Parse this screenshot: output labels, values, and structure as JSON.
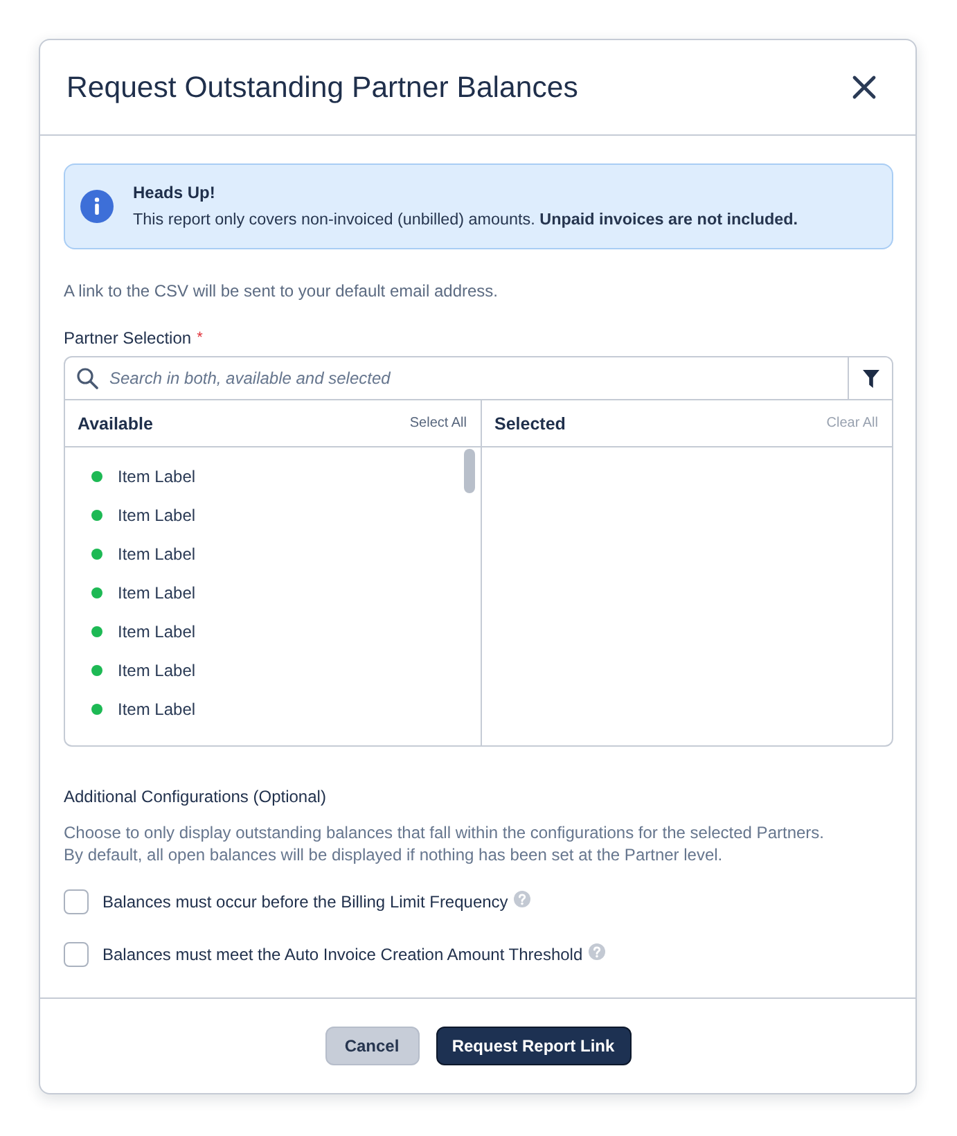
{
  "dialog": {
    "title": "Request Outstanding Partner Balances"
  },
  "alert": {
    "title": "Heads Up!",
    "message": "This report only covers non-invoiced (unbilled) amounts. **Unpaid invoices are not included.**"
  },
  "note": "A link to the CSV will be sent to your default email address.",
  "partner_selection": {
    "label": "Partner Selection",
    "required_mark": "*",
    "search": {
      "placeholder": "Search in both, available and selected"
    },
    "available": {
      "title": "Available",
      "action": {
        "label": "Select All",
        "disabled": false
      },
      "items": [
        {
          "label": "Item Label",
          "color": "#1db954"
        },
        {
          "label": "Item Label",
          "color": "#1db954"
        },
        {
          "label": "Item Label",
          "color": "#1db954"
        },
        {
          "label": "Item Label",
          "color": "#1db954"
        },
        {
          "label": "Item Label",
          "color": "#1db954"
        },
        {
          "label": "Item Label",
          "color": "#1db954"
        },
        {
          "label": "Item Label",
          "color": "#1db954"
        }
      ]
    },
    "selected": {
      "title": "Selected",
      "action": {
        "label": "Clear All",
        "disabled": true
      }
    }
  },
  "additional": {
    "title": "Additional Configurations (Optional)",
    "description": "Choose to only display outstanding balances that fall within the configurations for the selected Partners.\nBy default, all open balances will be displayed if nothing has been set at the Partner level.",
    "options": [
      {
        "label": "Balances must occur before the Billing Limit Frequency",
        "checked": false,
        "help": true
      },
      {
        "label": "Balances must meet the Auto Invoice Creation Amount Threshold",
        "checked": false,
        "help": true
      }
    ]
  },
  "buttons": [
    {
      "label": "Cancel",
      "kind": "secondary"
    },
    {
      "label": "Request Report Link",
      "kind": "primary"
    }
  ]
}
